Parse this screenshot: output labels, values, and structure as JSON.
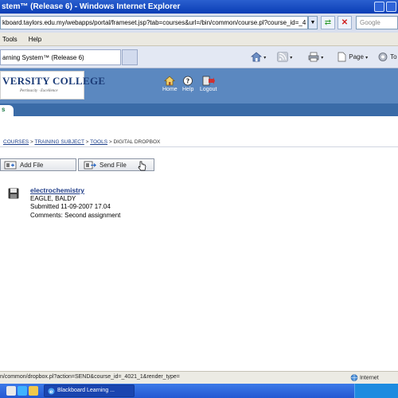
{
  "window": {
    "title": "stem™ (Release 6) - Windows Internet Explorer"
  },
  "address": {
    "url": "kboard.taylors.edu.my/webapps/portal/frameset.jsp?tab=courses&url=/bin/common/course.pl?course_id=_4",
    "search_placeholder": "Google"
  },
  "menu": {
    "items": [
      "Tools",
      "Help"
    ]
  },
  "browser_tab": {
    "label": "arning System™ (Release 6)"
  },
  "commands": {
    "page_label": "Page",
    "tools_label": "To"
  },
  "header": {
    "logo_text": "VERSITY COLLEGE",
    "logo_subtext": "Pertinacity · Excellence",
    "nav": [
      "Home",
      "Help",
      "Logout"
    ]
  },
  "page_tab": {
    "label": "s"
  },
  "breadcrumb": {
    "items": [
      "COURSES",
      "TRAINING SUBJECT",
      "TOOLS"
    ],
    "current": "DIGITAL DROPBOX",
    "separator": ">"
  },
  "actions": {
    "add_file": "Add File",
    "send_file": "Send File"
  },
  "entry": {
    "title": "electrochemistry",
    "author": "EAGLE, BALDY",
    "submitted": "Submitted 11-09-2007 17.04",
    "comments": "Comments: Second assignment"
  },
  "status": {
    "url": "n/common/dropbox.pl?action=SEND&course_id=_4021_1&render_type=",
    "zone": "Internet"
  },
  "taskbar": {
    "window_button": "Blackboard Learning ..."
  }
}
